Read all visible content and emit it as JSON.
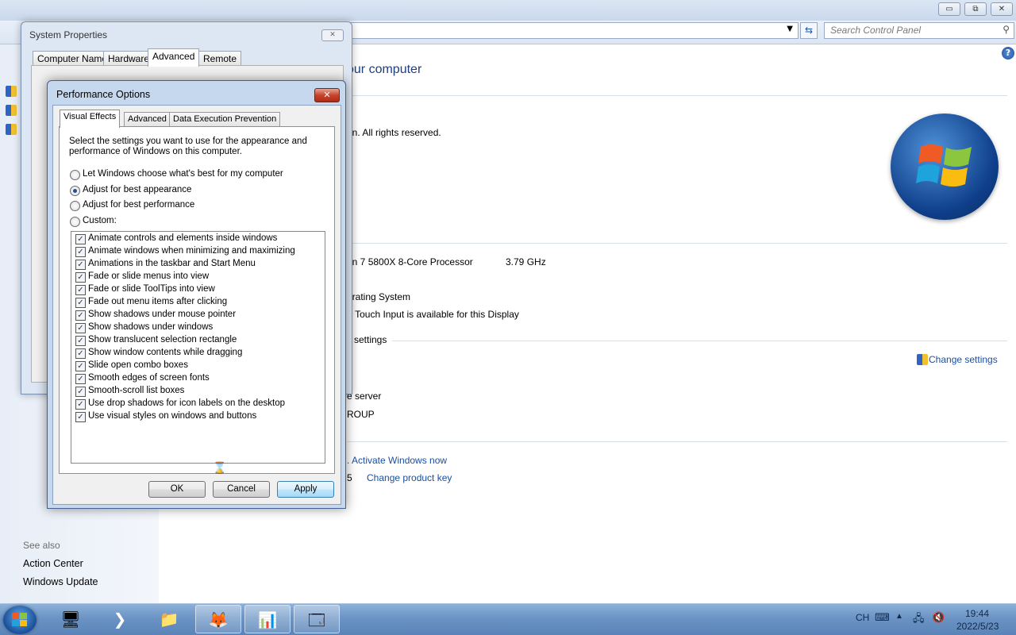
{
  "control_panel": {
    "search_placeholder": "Search Control Panel",
    "heading_partial": "our computer",
    "copyright_partial": "on.  All rights reserved.",
    "processor_partial": "en 7 5800X 8-Core Processor",
    "processor_speed": "3.79 GHz",
    "system_type_partial": "erating System",
    "pen_touch_partial": "r Touch Input is available for this Display",
    "computer_name_section_partial": "settings",
    "change_settings": "Change settings",
    "description_partial": "e server",
    "workgroup_partial": "ROUP",
    "activation_link": ". Activate Windows now",
    "product_id_partial": "5",
    "change_product_key": "Change product key",
    "see_also_title": "See also",
    "see_also_items": [
      "Action Center",
      "Windows Update"
    ],
    "caption_buttons": [
      "▭",
      "⧉",
      "✕"
    ]
  },
  "system_properties": {
    "title": "System Properties",
    "tabs": [
      "Computer Name",
      "Hardware",
      "Advanced",
      "Remote"
    ],
    "active_tab": "Advanced"
  },
  "performance_options": {
    "title": "Performance Options",
    "tabs": [
      "Visual Effects",
      "Advanced",
      "Data Execution Prevention"
    ],
    "active_tab": "Visual Effects",
    "description": "Select the settings you want to use for the appearance and performance of Windows on this computer.",
    "radios": [
      {
        "label": "Let Windows choose what's best for my computer",
        "checked": false
      },
      {
        "label": "Adjust for best appearance",
        "checked": true
      },
      {
        "label": "Adjust for best performance",
        "checked": false
      },
      {
        "label": "Custom:",
        "checked": false
      }
    ],
    "effects": [
      "Animate controls and elements inside windows",
      "Animate windows when minimizing and maximizing",
      "Animations in the taskbar and Start Menu",
      "Fade or slide menus into view",
      "Fade or slide ToolTips into view",
      "Fade out menu items after clicking",
      "Show shadows under mouse pointer",
      "Show shadows under windows",
      "Show translucent selection rectangle",
      "Show window contents while dragging",
      "Slide open combo boxes",
      "Smooth edges of screen fonts",
      "Smooth-scroll list boxes",
      "Use drop shadows for icon labels on the desktop",
      "Use visual styles on windows and buttons"
    ],
    "buttons": {
      "ok": "OK",
      "cancel": "Cancel",
      "apply": "Apply"
    }
  },
  "taskbar": {
    "language": "CH",
    "time": "19:44",
    "date": "2022/5/23"
  },
  "colors": {
    "link": "#1a4fa0",
    "taskbar": "#6b93c4",
    "dialog_frame": "#c6d8ee"
  }
}
